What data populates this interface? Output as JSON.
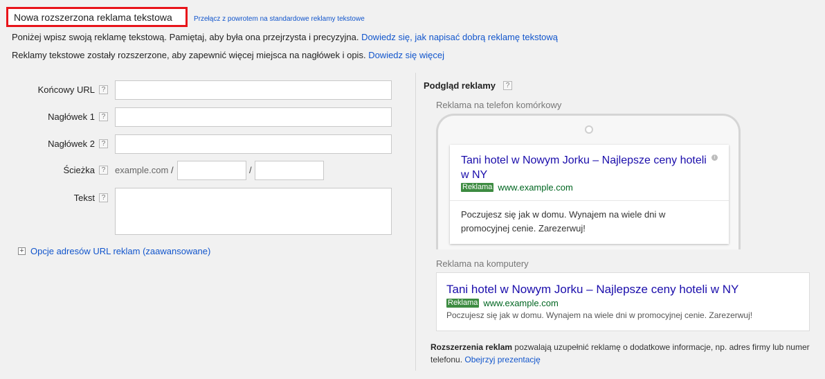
{
  "header": {
    "title": "Nowa rozszerzona reklama tekstowa",
    "switch_link": "Przełącz z powrotem na standardowe reklamy tekstowe"
  },
  "intro": {
    "line1_text": "Poniżej wpisz swoją reklamę tekstową. Pamiętaj, aby była ona przejrzysta i precyzyjna.",
    "line1_link": "Dowiedz się, jak napisać dobrą reklamę tekstową",
    "line2_text": "Reklamy tekstowe zostały rozszerzone, aby zapewnić więcej miejsca na nagłówek i opis.",
    "line2_link": "Dowiedz się więcej"
  },
  "form": {
    "final_url_label": "Końcowy URL",
    "headline1_label": "Nagłówek 1",
    "headline2_label": "Nagłówek 2",
    "path_label": "Ścieżka",
    "path_domain": "example.com",
    "path_separator": "/",
    "text_label": "Tekst",
    "help_glyph": "?",
    "advanced_expand_glyph": "+",
    "advanced_options": "Opcje adresów URL reklam (zaawansowane)",
    "values": {
      "final_url": "",
      "headline1": "",
      "headline2": "",
      "path1": "",
      "path2": "",
      "text": ""
    }
  },
  "preview": {
    "title": "Podgląd reklamy",
    "mobile_label": "Reklama na telefon komórkowy",
    "desktop_label": "Reklama na komputery",
    "ad": {
      "headline": "Tani hotel w Nowym Jorku – Najlepsze ceny hoteli w NY",
      "badge": "Reklama",
      "url": "www.example.com",
      "mobile_description": "Poczujesz się jak w domu. Wynajem na wiele dni w promocyjnej cenie. Zarezerwuj!",
      "desktop_description": "Poczujesz się jak w domu. Wynajem na wiele dni w promocyjnej cenie. Zarezerwuj!",
      "info_glyph": "i"
    },
    "extensions_bold": "Rozszerzenia reklam",
    "extensions_text": " pozwalają uzupełnić reklamę o dodatkowe informacje, np. adres firmy lub numer telefonu. ",
    "extensions_link": "Obejrzyj prezentację"
  },
  "colors": {
    "accent_link": "#1155cc",
    "highlight_border": "#e8141a",
    "ad_headline": "#1a0dab",
    "ad_url": "#006621",
    "ad_badge": "#3d8b41"
  }
}
